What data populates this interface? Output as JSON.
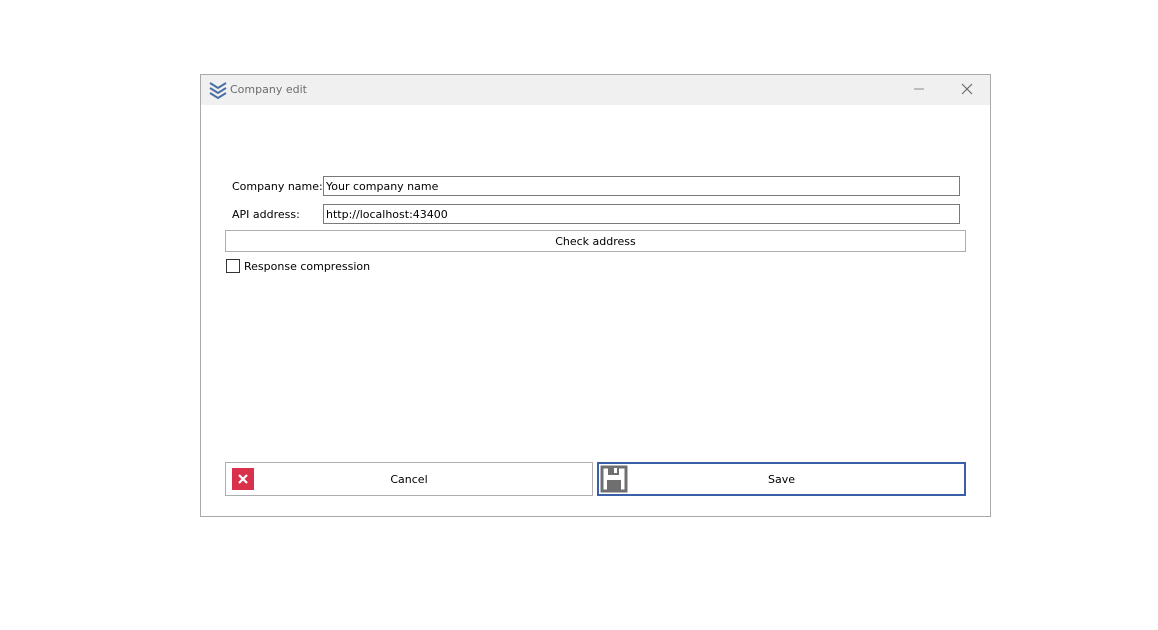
{
  "window": {
    "title": "Company edit",
    "app_icon": "stacked-chevrons-icon",
    "minimize_icon": "minimize-icon",
    "close_icon": "close-icon"
  },
  "form": {
    "company_name_label": "Company name:",
    "company_name_value": "Your company name",
    "api_address_label": "API address:",
    "api_address_value": "http://localhost:43400",
    "check_address_label": "Check address",
    "response_compression_label": "Response compression",
    "response_compression_checked": false
  },
  "actions": {
    "cancel_label": "Cancel",
    "cancel_icon": "close-x-icon",
    "save_label": "Save",
    "save_icon": "floppy-disk-icon"
  },
  "colors": {
    "cancel_icon_bg": "#d9304b",
    "save_border": "#3a5fa8",
    "app_icon": "#4a6fa5"
  }
}
